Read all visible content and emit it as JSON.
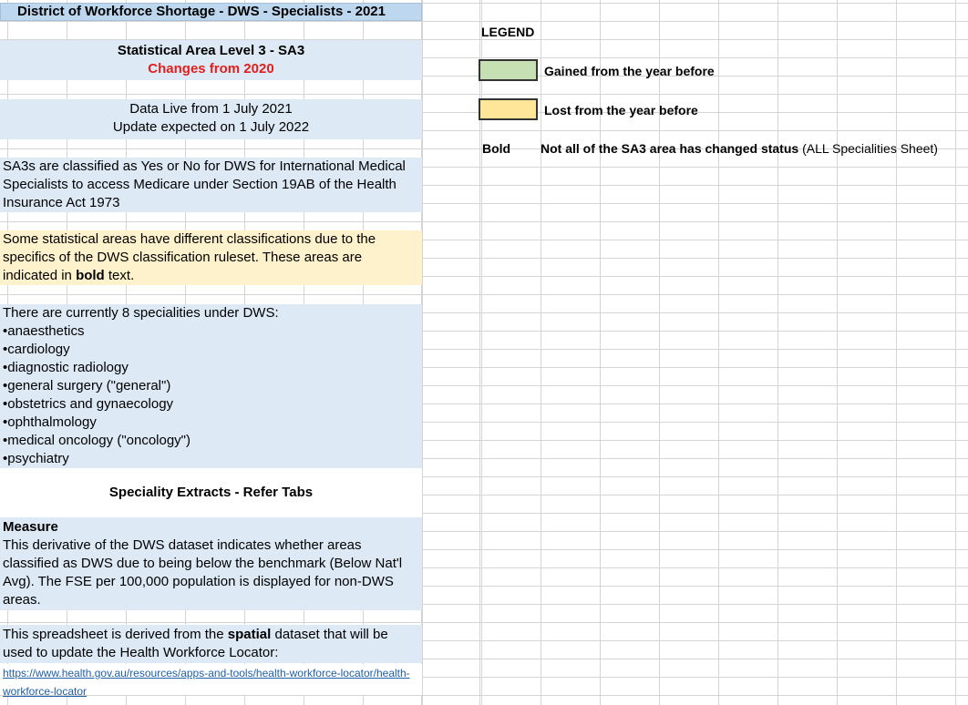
{
  "title": "District of Workforce Shortage - DWS - Specialists - 2021",
  "sa3": {
    "heading": "Statistical Area Level 3 - SA3",
    "changes": "Changes from 2020"
  },
  "dates": {
    "live": "Data Live from 1 July 2021",
    "update": "Update expected on 1 July 2022"
  },
  "classified_text": "SA3s are classified as Yes or No for DWS for International Medical Specialists to access Medicare under Section 19AB of the Health Insurance Act 1973",
  "note": {
    "before": "Some statistical areas have different classifications due to the specifics of the DWS classification ruleset. These areas are indicated in ",
    "bold": "bold",
    "after": " text."
  },
  "specialities": {
    "intro": "There are currently 8 specialities under DWS:",
    "items": [
      "•anaesthetics",
      "•cardiology",
      "•diagnostic radiology",
      "•general surgery (\"general\")",
      "•obstetrics and gynaecology",
      "•ophthalmology",
      "•medical oncology (\"oncology\")",
      "•psychiatry"
    ]
  },
  "extracts_heading": "Speciality Extracts - Refer Tabs",
  "measure": {
    "heading": "Measure",
    "text": "This derivative of the DWS dataset indicates whether areas classified as DWS due to being below the benchmark (Below Nat'l Avg). The FSE per 100,000 population is displayed for non-DWS areas."
  },
  "derived": {
    "before": "This spreadsheet is derived from the ",
    "bold": "spatial",
    "after": " dataset that will be used to update the Health Workforce Locator:",
    "link": "https://www.health.gov.au/resources/apps-and-tools/health-workforce-locator/health-workforce-locator"
  },
  "legend": {
    "heading": "LEGEND",
    "gained": "Gained from the year before",
    "lost": "Lost from the year before",
    "bold_key": "Bold",
    "bold_desc": "Not all of the SA3 area has changed status",
    "bold_note": " (ALL Specialities Sheet)",
    "gained_color": "#c6e0b4",
    "lost_color": "#ffe699"
  }
}
